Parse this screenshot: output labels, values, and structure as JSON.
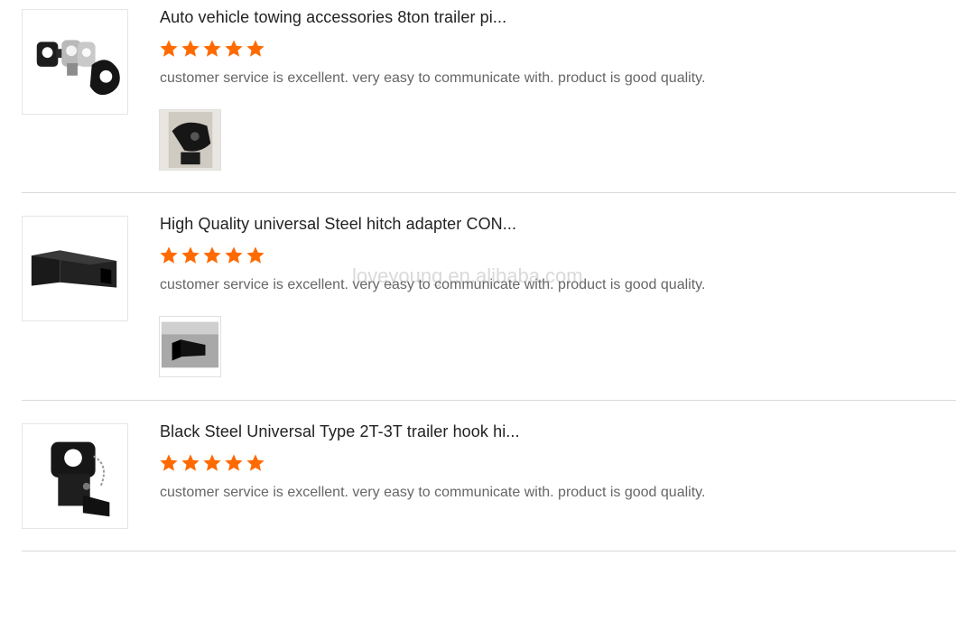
{
  "reviews": [
    {
      "title": "Auto vehicle towing accessories 8ton trailer pi...",
      "rating": 5,
      "comment": "customer service is excellent. very easy to communicate with. product is good quality.",
      "thumbnail_icon": "pintle-hook-set-image",
      "photo_icon": "customer-photo-pintle-hook"
    },
    {
      "title": "High Quality universal Steel hitch adapter CON...",
      "rating": 5,
      "comment": "customer service is excellent. very easy to communicate with. product is good quality.",
      "thumbnail_icon": "hitch-adapter-image",
      "photo_icon": "customer-photo-hitch-adapter"
    },
    {
      "title": "Black Steel Universal Type 2T-3T trailer hook hi...",
      "rating": 5,
      "comment": "customer service is excellent. very easy to communicate with. product is good quality.",
      "thumbnail_icon": "trailer-hook-image"
    }
  ],
  "watermark": "loveyoung.en.alibaba.com",
  "colors": {
    "star": "#ff6a00",
    "title": "#222222",
    "comment": "#666666",
    "divider": "#d9d9d9"
  }
}
